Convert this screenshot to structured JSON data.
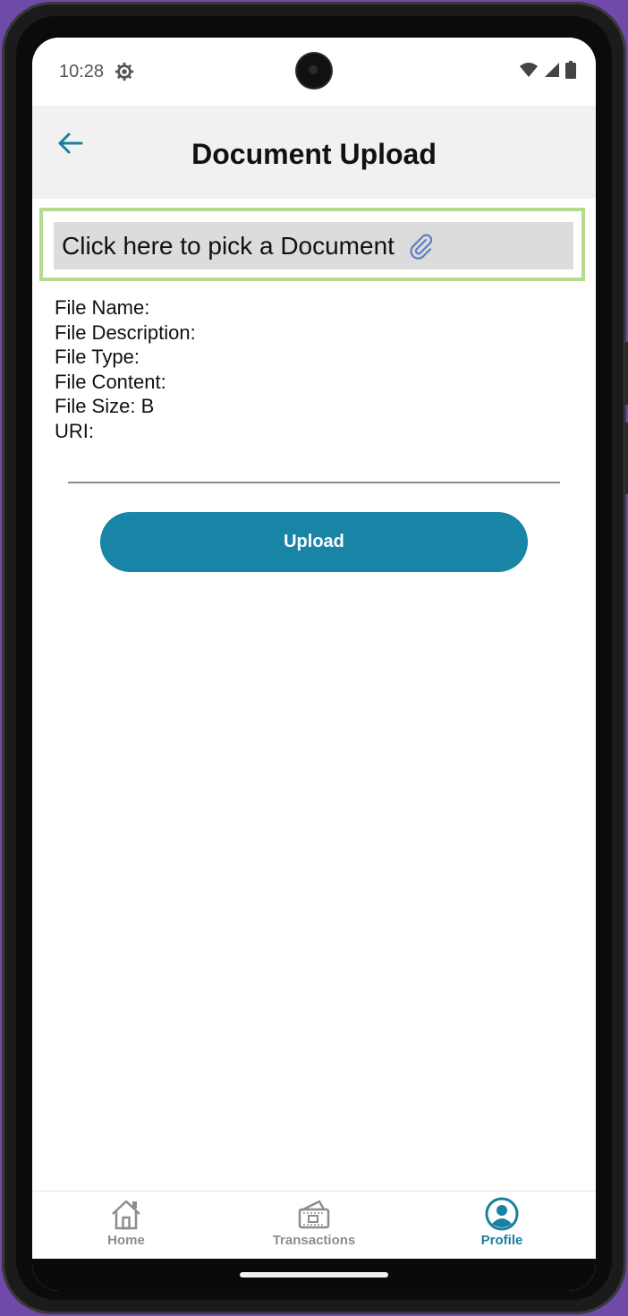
{
  "status_bar": {
    "time": "10:28"
  },
  "header": {
    "title": "Document Upload"
  },
  "picker": {
    "label": "Click here to pick a Document"
  },
  "file_info": [
    "File Name:",
    "File Description:",
    "File Type:",
    "File Content:",
    "File Size: B",
    "URI:"
  ],
  "actions": {
    "upload_label": "Upload"
  },
  "bottom_nav": {
    "items": [
      {
        "label": "Home",
        "icon": "home-icon",
        "active": false
      },
      {
        "label": "Transactions",
        "icon": "wallet-icon",
        "active": false
      },
      {
        "label": "Profile",
        "icon": "profile-icon",
        "active": true
      }
    ]
  },
  "colors": {
    "accent": "#1884a6",
    "picker_border": "#b5db8e",
    "header_bg": "#f1f1f1",
    "nav_inactive": "#8d8d8d"
  }
}
